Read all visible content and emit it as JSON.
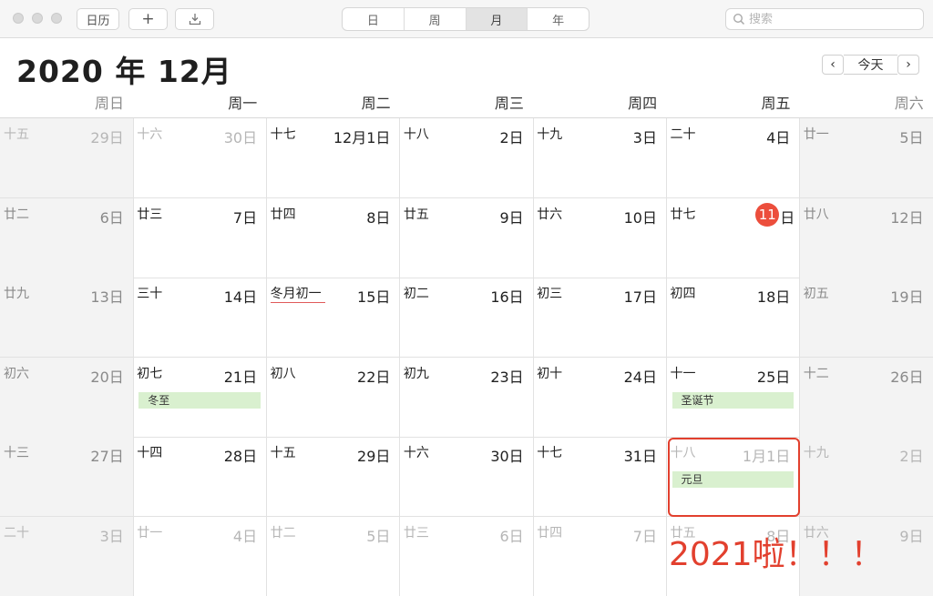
{
  "toolbar": {
    "calendars_label": "日历",
    "add_label": "+",
    "views": [
      {
        "label": "日",
        "active": false
      },
      {
        "label": "周",
        "active": false
      },
      {
        "label": "月",
        "active": true
      },
      {
        "label": "年",
        "active": false
      }
    ],
    "search_placeholder": "搜索"
  },
  "header": {
    "title": "2020 年 12月",
    "prev_label": "‹",
    "today_label": "今天",
    "next_label": "›"
  },
  "weekdays": [
    "周日",
    "周一",
    "周二",
    "周三",
    "周四",
    "周五",
    "周六"
  ],
  "weeks": [
    [
      {
        "lunar": "十五",
        "day": "29日",
        "faded": true
      },
      {
        "lunar": "十六",
        "day": "30日",
        "faded": true
      },
      {
        "lunar": "十七",
        "day": "12月1日"
      },
      {
        "lunar": "十八",
        "day": "2日"
      },
      {
        "lunar": "十九",
        "day": "3日"
      },
      {
        "lunar": "二十",
        "day": "4日"
      },
      {
        "lunar": "廿一",
        "day": "5日"
      }
    ],
    [
      {
        "lunar": "廿二",
        "day": "6日"
      },
      {
        "lunar": "廿三",
        "day": "7日"
      },
      {
        "lunar": "廿四",
        "day": "8日"
      },
      {
        "lunar": "廿五",
        "day": "9日"
      },
      {
        "lunar": "廿六",
        "day": "10日"
      },
      {
        "lunar": "廿七",
        "day": "11",
        "day_suffix": "日",
        "today": true
      },
      {
        "lunar": "廿八",
        "day": "12日"
      }
    ],
    [
      {
        "lunar": "廿九",
        "day": "13日"
      },
      {
        "lunar": "三十",
        "day": "14日"
      },
      {
        "lunar": "冬月初一",
        "day": "15日",
        "underline": true
      },
      {
        "lunar": "初二",
        "day": "16日"
      },
      {
        "lunar": "初三",
        "day": "17日"
      },
      {
        "lunar": "初四",
        "day": "18日"
      },
      {
        "lunar": "初五",
        "day": "19日"
      }
    ],
    [
      {
        "lunar": "初六",
        "day": "20日"
      },
      {
        "lunar": "初七",
        "day": "21日",
        "event": "冬至"
      },
      {
        "lunar": "初八",
        "day": "22日"
      },
      {
        "lunar": "初九",
        "day": "23日"
      },
      {
        "lunar": "初十",
        "day": "24日"
      },
      {
        "lunar": "十一",
        "day": "25日",
        "event": "圣诞节"
      },
      {
        "lunar": "十二",
        "day": "26日"
      }
    ],
    [
      {
        "lunar": "十三",
        "day": "27日"
      },
      {
        "lunar": "十四",
        "day": "28日"
      },
      {
        "lunar": "十五",
        "day": "29日"
      },
      {
        "lunar": "十六",
        "day": "30日"
      },
      {
        "lunar": "十七",
        "day": "31日"
      },
      {
        "lunar": "十八",
        "day": "1月1日",
        "faded": true,
        "event": "元旦"
      },
      {
        "lunar": "十九",
        "day": "2日",
        "faded": true
      }
    ],
    [
      {
        "lunar": "二十",
        "day": "3日",
        "faded": true
      },
      {
        "lunar": "廿一",
        "day": "4日",
        "faded": true
      },
      {
        "lunar": "廿二",
        "day": "5日",
        "faded": true
      },
      {
        "lunar": "廿三",
        "day": "6日",
        "faded": true
      },
      {
        "lunar": "廿四",
        "day": "7日",
        "faded": true
      },
      {
        "lunar": "廿五",
        "day": "8日",
        "faded": true
      },
      {
        "lunar": "廿六",
        "day": "9日",
        "faded": true
      }
    ]
  ],
  "annotation": "2021啦！！！",
  "colors": {
    "today": "#ec4e3c",
    "event_bg": "#d9f0cf",
    "annotation": "#e2402e"
  }
}
